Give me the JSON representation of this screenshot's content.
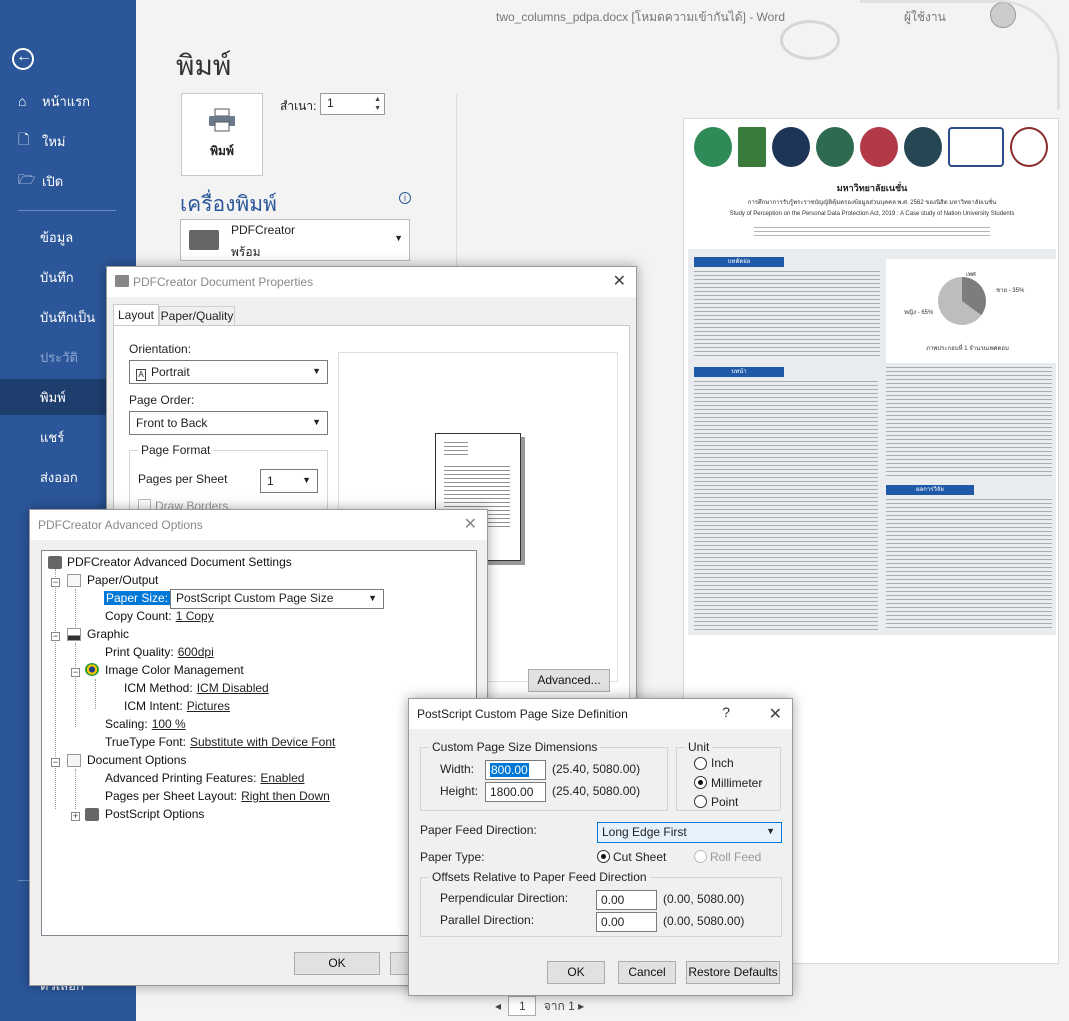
{
  "window": {
    "title": "two_columns_pdpa.docx [โหมดความเข้ากันได้] - Word",
    "user": "ผู้ใช้งาน"
  },
  "sidebar": {
    "items": [
      {
        "label": "หน้าแรก",
        "icon": "home-icon"
      },
      {
        "label": "ใหม่",
        "icon": "new-doc-icon"
      },
      {
        "label": "เปิด",
        "icon": "folder-icon"
      },
      {
        "label": "ข้อมูล"
      },
      {
        "label": "บันทึก"
      },
      {
        "label": "บันทึกเป็น"
      },
      {
        "label": "ประวัติ"
      },
      {
        "label": "พิมพ์"
      },
      {
        "label": "แชร์"
      },
      {
        "label": "ส่งออก"
      },
      {
        "label": "ตัวเลือก"
      }
    ]
  },
  "print": {
    "title": "พิมพ์",
    "print_button": "พิมพ์",
    "copies_label": "สำเนา:",
    "copies_value": "1",
    "printer_header": "เครื่องพิมพ์",
    "printer_name": "PDFCreator",
    "printer_status": "พร้อม"
  },
  "preview": {
    "title": "มหาวิทยาลัยเนชั่น",
    "subtitle_th": "การศึกษาการรับรู้พระราชบัญญัติคุ้มครองข้อมูลส่วนบุคคล พ.ศ. 2562 ของนิสิต มหาวิทยาลัยเนชั่น",
    "subtitle_en": "Study of Perception on the Personal Data Protection Act, 2019 : A Case study of Nation University Students",
    "section_1": "บทคัดย่อ",
    "section_2": "บทนำ",
    "section_3": "ผลการวิจัย",
    "pie_caption": "ภาพประกอบที่ 1 จำนวนเพศตอบ",
    "pie_label_1": "ชาย - 35%",
    "pie_label_2": "หญิง - 65%",
    "pie_label_3": "เพศ",
    "page_label": "จาก 1",
    "page_value": "1"
  },
  "props_dialog": {
    "title": "PDFCreator Document Properties",
    "tabs": [
      "Layout",
      "Paper/Quality"
    ],
    "orientation_label": "Orientation:",
    "orientation_value": "Portrait",
    "page_order_label": "Page Order:",
    "page_order_value": "Front to Back",
    "page_format_label": "Page Format",
    "pages_per_sheet_label": "Pages per Sheet",
    "pages_per_sheet_value": "1",
    "draw_borders_label": "Draw Borders",
    "advanced_button": "Advanced..."
  },
  "advanced_dialog": {
    "title": "PDFCreator Advanced Options",
    "root": "PDFCreator Advanced Document Settings",
    "paper_output": "Paper/Output",
    "paper_size_label": "Paper Size:",
    "paper_size_value": "PostScript Custom Page Size",
    "copy_count_label": "Copy Count:",
    "copy_count_value": "1 Copy",
    "graphic": "Graphic",
    "print_quality_label": "Print Quality:",
    "print_quality_value": "600dpi",
    "icm": "Image Color Management",
    "icm_method_label": "ICM Method:",
    "icm_method_value": "ICM Disabled",
    "icm_intent_label": "ICM Intent:",
    "icm_intent_value": "Pictures",
    "scaling_label": "Scaling:",
    "scaling_value": "100 %",
    "truetype_label": "TrueType Font:",
    "truetype_value": "Substitute with Device Font",
    "doc_options": "Document Options",
    "adv_features_label": "Advanced Printing Features:",
    "adv_features_value": "Enabled",
    "pps_layout_label": "Pages per Sheet Layout:",
    "pps_layout_value": "Right then Down",
    "postscript_options": "PostScript Options",
    "ok": "OK"
  },
  "ps_dialog": {
    "title": "PostScript Custom Page Size Definition",
    "help": "?",
    "dims_group": "Custom Page Size Dimensions",
    "width_label": "Width:",
    "width_value": "800.00",
    "width_range": "(25.40, 5080.00)",
    "height_label": "Height:",
    "height_value": "1800.00",
    "height_range": "(25.40, 5080.00)",
    "unit_group": "Unit",
    "unit_inch": "Inch",
    "unit_mm": "Millimeter",
    "unit_point": "Point",
    "feed_label": "Paper Feed Direction:",
    "feed_value": "Long Edge First",
    "type_label": "Paper Type:",
    "type_cut": "Cut Sheet",
    "type_roll": "Roll Feed",
    "offsets_group": "Offsets Relative to Paper Feed Direction",
    "perp_label": "Perpendicular Direction:",
    "perp_value": "0.00",
    "perp_range": "(0.00, 5080.00)",
    "par_label": "Parallel Direction:",
    "par_value": "0.00",
    "par_range": "(0.00, 5080.00)",
    "ok": "OK",
    "cancel": "Cancel",
    "restore": "Restore Defaults"
  },
  "colors": {
    "word_blue": "#2b579a",
    "sidebar_active": "#1e3e6e",
    "selection": "#0078d7"
  }
}
